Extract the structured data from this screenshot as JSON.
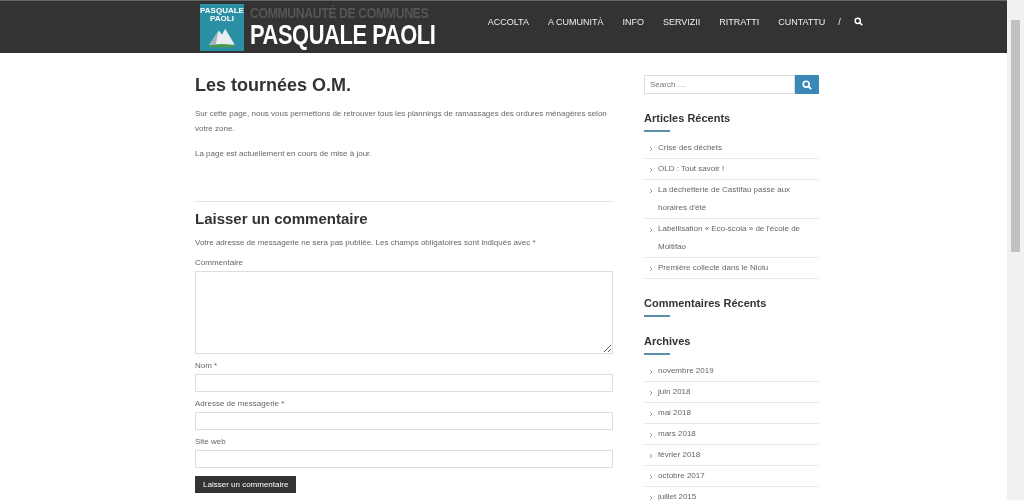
{
  "header": {
    "logo_badge": "PASQUALE PAOLI",
    "logo_line1": "COMMUNAUTÉ DE COMMUNES",
    "logo_line2": "PASQUALE PAOLI",
    "nav": [
      {
        "label": "ACCOLTA",
        "selected": false
      },
      {
        "label": "A CUMUNITÀ",
        "selected": false
      },
      {
        "label": "INFO",
        "selected": false
      },
      {
        "label": "SERVIZII",
        "selected": false
      },
      {
        "label": "RITRATTI",
        "selected": false
      },
      {
        "label": "CUNTATTU",
        "selected": false
      }
    ],
    "separator": "/"
  },
  "article": {
    "title": "Les tournées O.M.",
    "paragraphs": [
      "Sur cette page, nous vous permettons de retrouver tous les plannings de ramassages des ordures ménagères selon votre zone.",
      "La page est actuellement en cours de mise à jour."
    ]
  },
  "comment_form": {
    "title": "Laisser un commentaire",
    "notice": "Votre adresse de messagerie ne sera pas publiée. Les champs obligatoires sont indiqués avec *",
    "fields": [
      {
        "kind": "textarea",
        "label": "Commentaire"
      },
      {
        "kind": "input",
        "label": "Nom *"
      },
      {
        "kind": "input",
        "label": "Adresse de messagerie *"
      },
      {
        "kind": "input",
        "label": "Site web"
      }
    ],
    "submit": "Laisser un commentaire"
  },
  "sidebar": {
    "search": {
      "placeholder": "Search …"
    },
    "widgets": [
      {
        "title": "Articles Récents",
        "items": [
          "Crise des déchets",
          "OLD : Tout savoir !",
          "La déchetterie de Castifau passe aux horaires d'été",
          "Labellisation « Eco-scola » de l'école de Moltifao",
          "Première collecte dans le Niolu"
        ]
      },
      {
        "title": "Commentaires Récents"
      },
      {
        "title": "Archives",
        "items": [
          "novembre 2019",
          "juin 2018",
          "mai 2018",
          "mars 2018",
          "février 2018",
          "octobre 2017",
          "juillet 2015"
        ]
      }
    ]
  }
}
